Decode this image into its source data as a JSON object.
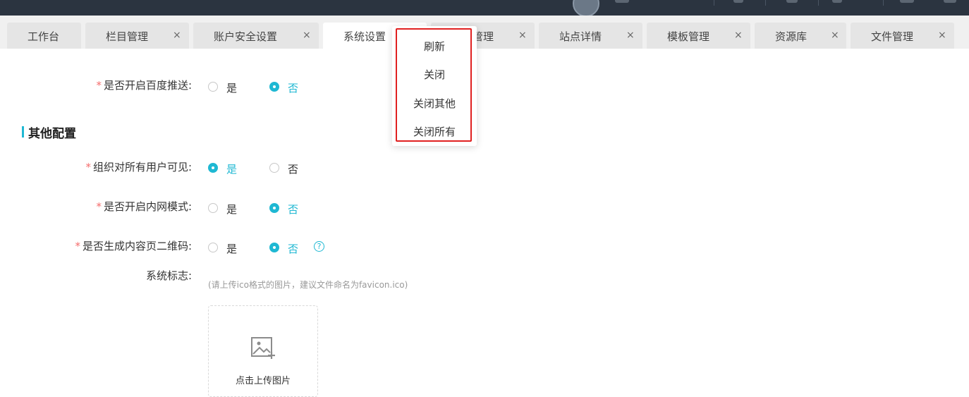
{
  "tabs": [
    {
      "label": "工作台",
      "closable": false,
      "active": false
    },
    {
      "label": "栏目管理",
      "closable": true,
      "active": false
    },
    {
      "label": "账户安全设置",
      "closable": true,
      "active": false
    },
    {
      "label": "系统设置",
      "closable": true,
      "active": true
    },
    {
      "label": "管理",
      "closable": true,
      "active": false
    },
    {
      "label": "站点详情",
      "closable": true,
      "active": false
    },
    {
      "label": "模板管理",
      "closable": true,
      "active": false
    },
    {
      "label": "资源库",
      "closable": true,
      "active": false
    },
    {
      "label": "文件管理",
      "closable": true,
      "active": false
    }
  ],
  "close_symbol": "×",
  "context_menu": {
    "items": [
      "刷新",
      "关闭",
      "关闭其他",
      "关闭所有"
    ]
  },
  "form": {
    "required_mark": "*",
    "baidu_push": {
      "label": "是否开启百度推送:",
      "options": [
        "是",
        "否"
      ],
      "selected": "否"
    },
    "section_title": "其他配置",
    "org_visible": {
      "label": "组织对所有用户可见:",
      "options": [
        "是",
        "否"
      ],
      "selected": "是"
    },
    "intranet_mode": {
      "label": "是否开启内网模式:",
      "options": [
        "是",
        "否"
      ],
      "selected": "否"
    },
    "qr_code": {
      "label": "是否生成内容页二维码:",
      "options": [
        "是",
        "否"
      ],
      "selected": "否",
      "help_symbol": "?"
    },
    "system_logo": {
      "label": "系统标志:",
      "hint": "(请上传ico格式的图片，建议文件命名为favicon.ico)",
      "upload_text": "点击上传图片"
    }
  },
  "colors": {
    "accent": "#1fb8d3",
    "required": "#f56c6c",
    "highlight_border": "#e02020",
    "topbar": "#2b3440"
  },
  "icons": [
    "avatar",
    "close-icon",
    "help-icon",
    "image-upload-icon"
  ]
}
